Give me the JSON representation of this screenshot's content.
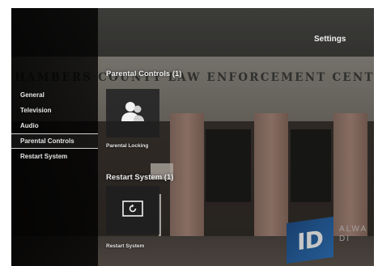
{
  "background": {
    "building_sign": "HAMBERS COUNTY LAW ENFORCEMENT CENTER",
    "logo": "ID",
    "watermark": "ALWA\nDI"
  },
  "header": {
    "title": "Settings"
  },
  "sidebar": {
    "items": [
      {
        "label": "General",
        "active": false
      },
      {
        "label": "Television",
        "active": false
      },
      {
        "label": "Audio",
        "active": false
      },
      {
        "label": "Parental Controls",
        "active": true
      },
      {
        "label": "Restart System",
        "active": false
      }
    ]
  },
  "sections": [
    {
      "title": "Parental Controls (1)",
      "tiles": [
        {
          "label": "Parental Locking",
          "icon": "users-icon"
        }
      ]
    },
    {
      "title": "Restart System (1)",
      "tiles": [
        {
          "label": "Restart System",
          "icon": "restart-icon"
        }
      ]
    }
  ],
  "colors": {
    "sidebar_bg": "#000000",
    "text": "#e6e6e6",
    "tile_bg": "#1e1e20"
  }
}
